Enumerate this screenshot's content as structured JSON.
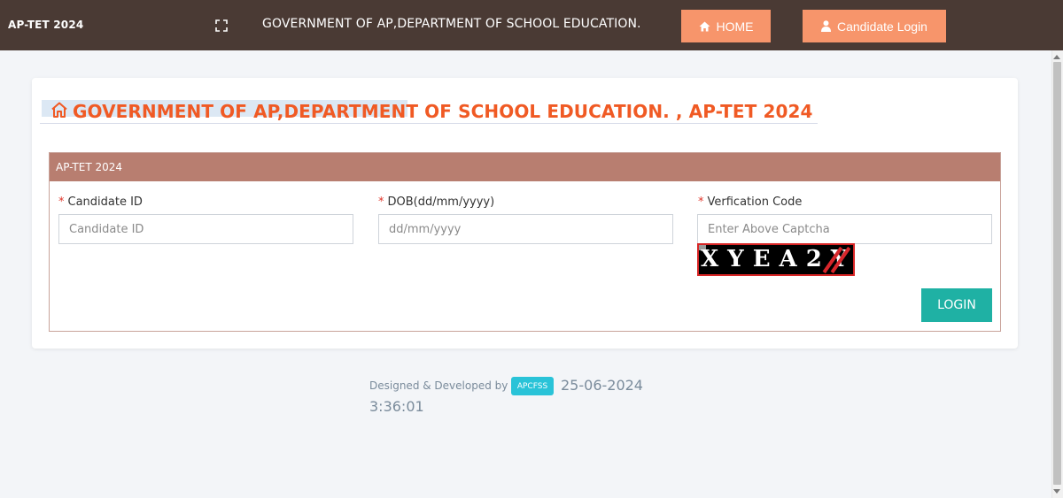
{
  "navbar": {
    "brand": "AP-TET 2024",
    "title": "GOVERNMENT OF AP,DEPARTMENT OF SCHOOL EDUCATION.",
    "home_label": "HOME",
    "login_label": "Candidate Login",
    "fullscreen_icon": "expand-icon",
    "home_icon": "home-icon",
    "user_icon": "user-icon",
    "bg_color": "#4a3a34",
    "button_color": "#f7956b"
  },
  "page": {
    "title": "GOVERNMENT OF AP,DEPARTMENT OF SCHOOL EDUCATION. , AP-TET 2024",
    "title_color": "#f05a24",
    "title_icon": "home-outline-icon"
  },
  "panel": {
    "heading": "AP-TET 2024",
    "heading_color": "#b87e70",
    "required_mark": "*",
    "fields": [
      {
        "label": "Candidate ID",
        "placeholder": "Candidate ID",
        "value": ""
      },
      {
        "label": "DOB(dd/mm/yyyy)",
        "placeholder": "dd/mm/yyyy",
        "value": ""
      },
      {
        "label": "Verfication Code",
        "placeholder": "Enter Above Captcha",
        "value": ""
      }
    ],
    "captcha_text": "XYEA2Y",
    "login_label": "LOGIN",
    "login_color": "#1fb1a4"
  },
  "footer": {
    "designed_by": "Designed & Developed by",
    "badge": "APCFSS",
    "date": "25-06-2024",
    "time": "3:36:01"
  }
}
